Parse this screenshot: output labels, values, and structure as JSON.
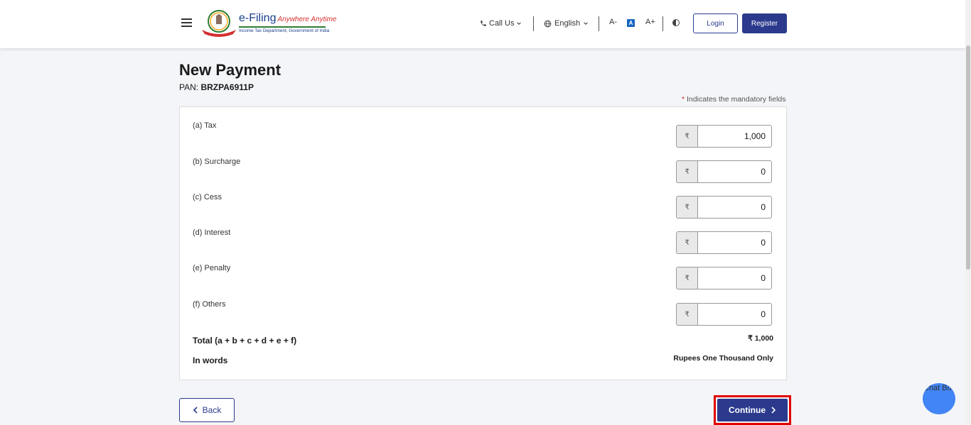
{
  "header": {
    "logo_title": "e-Filing",
    "logo_tagline": "Anywhere Anytime",
    "logo_subtitle": "Income Tax Department, Government of India",
    "call_us": "Call Us",
    "language": "English",
    "font_decrease": "A-",
    "font_default": "A",
    "font_increase": "A+",
    "login": "Login",
    "register": "Register"
  },
  "page": {
    "title": "New Payment",
    "pan_label": "PAN:",
    "pan_value": "BRZPA6911P",
    "mandatory_star": "*",
    "mandatory_text": "Indicates the mandatory fields"
  },
  "payment": {
    "currency_symbol": "₹",
    "rows": [
      {
        "label": "(a) Tax",
        "value": "1,000"
      },
      {
        "label": "(b) Surcharge",
        "value": "0"
      },
      {
        "label": "(c) Cess",
        "value": "0"
      },
      {
        "label": "(d) Interest",
        "value": "0"
      },
      {
        "label": "(e) Penalty",
        "value": "0"
      },
      {
        "label": "(f) Others",
        "value": "0"
      }
    ],
    "total_label": "Total (a + b + c + d + e + f)",
    "total_value": "₹ 1,000",
    "words_label": "In words",
    "words_value": "Rupees One Thousand Only"
  },
  "actions": {
    "back": "Back",
    "continue": "Continue"
  },
  "chatbot": {
    "alt": "Chat Bot"
  },
  "colors": {
    "primary": "#2b3a8c",
    "highlight_border": "#e00000",
    "background": "#f4f5f8"
  }
}
